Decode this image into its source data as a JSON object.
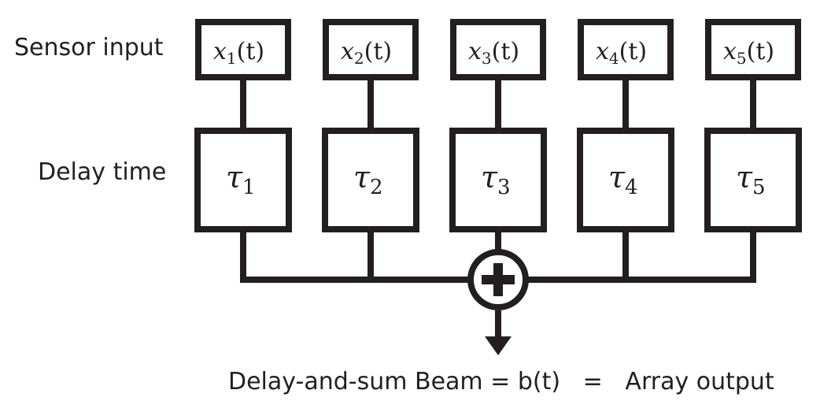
{
  "row_labels": {
    "sensor": "Sensor input",
    "delay": "Delay time"
  },
  "channels": [
    {
      "signal": "x",
      "index": "1",
      "arg": "(t)",
      "delay": "τ"
    },
    {
      "signal": "x",
      "index": "2",
      "arg": "(t)",
      "delay": "τ"
    },
    {
      "signal": "x",
      "index": "3",
      "arg": "(t)",
      "delay": "τ"
    },
    {
      "signal": "x",
      "index": "4",
      "arg": "(t)",
      "delay": "τ"
    },
    {
      "signal": "x",
      "index": "5",
      "arg": "(t)",
      "delay": "τ"
    }
  ],
  "summer_icon": "plus-circle-icon",
  "output_label": "Delay-and-sum Beam = b(t)   =   Array output",
  "colors": {
    "stroke": "#231f20",
    "background": "#ffffff"
  }
}
